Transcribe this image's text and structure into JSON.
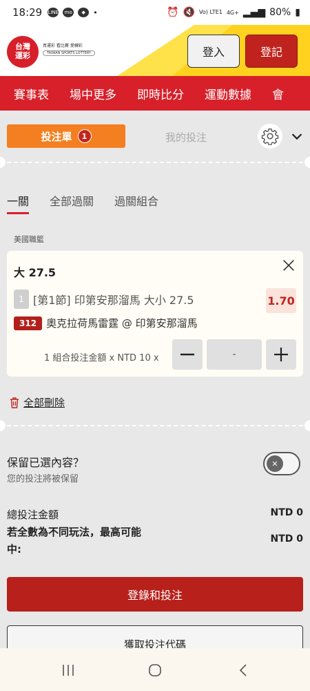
{
  "status_bar": {
    "time": "18:29",
    "battery": "80%",
    "network": "4G+",
    "volte": "Vo) LTE1"
  },
  "header": {
    "logo_text": "台灣運彩",
    "logo_tagline": "買運彩 看比賽 愛轉彩",
    "logo_en": "TAIWAN SPORTS LOTTERY",
    "login_label": "登入",
    "register_label": "登記"
  },
  "nav": {
    "items": [
      "賽事表",
      "場中更多",
      "即時比分",
      "運動數據",
      "會"
    ]
  },
  "betslip": {
    "tab_label": "投注單",
    "tab_count": "1",
    "mybets_label": "我的投注",
    "subtabs": [
      "一關",
      "全部過關",
      "過關組合"
    ],
    "league": "美國職籃",
    "bet": {
      "title": "大 27.5",
      "index": "1",
      "selection": "[第1節] 印第安那溜馬 大小 27.5",
      "odds": "1.70",
      "game_number": "312",
      "match": "奧克拉荷馬雷霆 @ 印第安那溜馬",
      "stake_label": "1 組合投注金額 x NTD 10 x",
      "stake_value": "-"
    },
    "delete_all": "全部刪除",
    "keep_title": "保留已選內容？",
    "keep_sub": "您的投注將被保留",
    "total_label": "總投注金額",
    "total_value": "NTD 0",
    "max_label": "若全數為不同玩法，最高可能中:",
    "max_value": "NTD 0",
    "submit_label": "登錄和投注",
    "code_label": "獲取投注代碼"
  }
}
